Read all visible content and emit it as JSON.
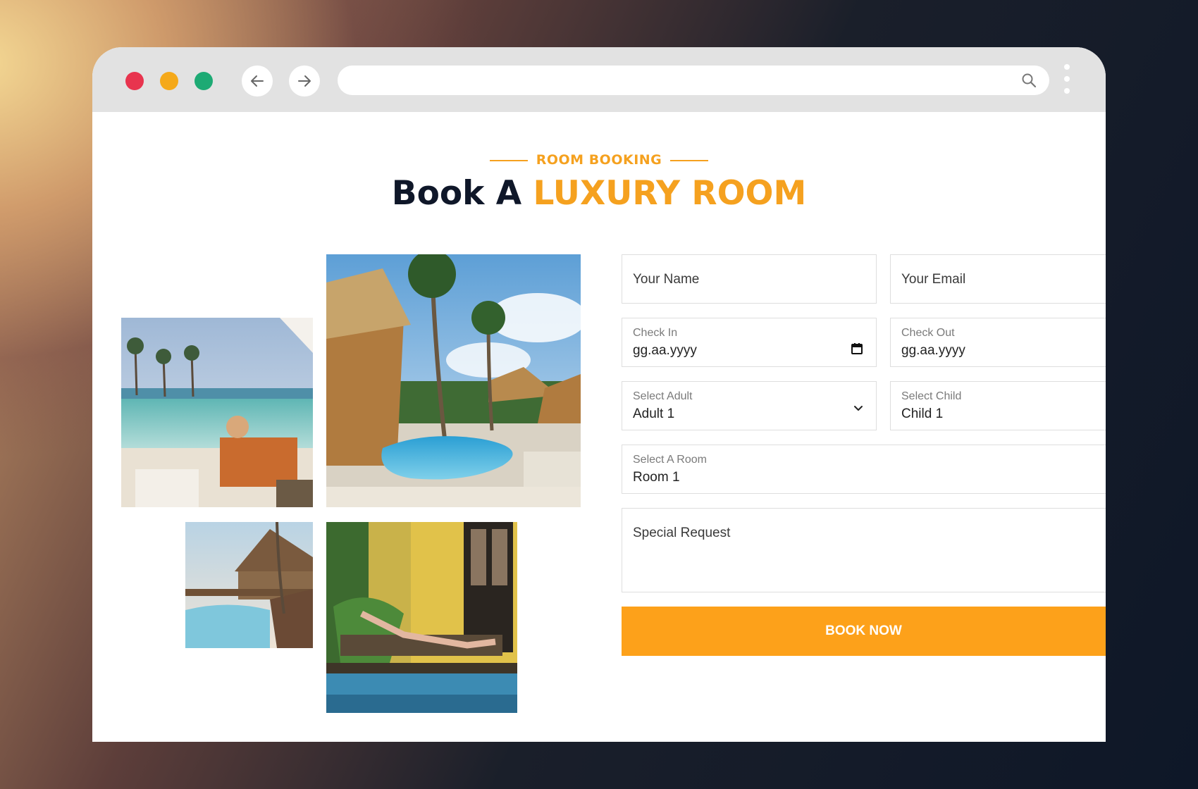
{
  "browser": {
    "url": "",
    "icons": {
      "back": "arrow-left-icon",
      "forward": "arrow-right-icon",
      "search": "search-icon",
      "menu": "kebab-menu-icon"
    }
  },
  "hero": {
    "eyebrow": "ROOM BOOKING",
    "title_prefix": "Book A ",
    "title_accent": "LUXURY ROOM"
  },
  "form": {
    "name_placeholder": "Your Name",
    "email_placeholder": "Your Email",
    "checkin_label": "Check In",
    "checkin_value": "gg.aa.yyyy",
    "checkout_label": "Check Out",
    "checkout_value": "gg.aa.yyyy",
    "adult_label": "Select Adult",
    "adult_value": "Adult 1",
    "child_label": "Select Child",
    "child_value": "Child 1",
    "room_label": "Select A Room",
    "room_value": "Room 1",
    "request_placeholder": "Special Request",
    "submit_label": "BOOK NOW"
  },
  "colors": {
    "accent": "#fda11a",
    "heading": "#0f1729",
    "traffic_red": "#e8344e",
    "traffic_yellow": "#f5a91a",
    "traffic_green": "#1daa74"
  }
}
